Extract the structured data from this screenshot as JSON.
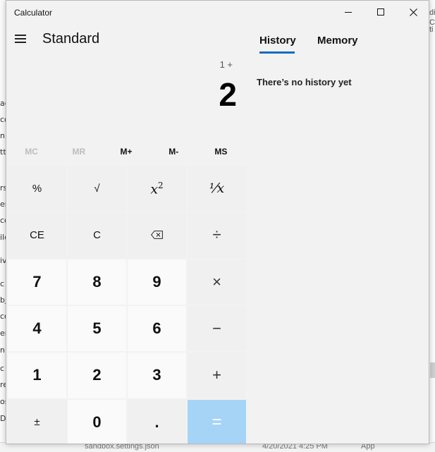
{
  "background_app": {
    "left_fragments": [
      "ac",
      "co",
      "nl",
      "tt",
      "rs",
      "en",
      "co",
      "ile",
      "iv",
      "c",
      "bj",
      "co",
      "en",
      "nl",
      "c",
      "re",
      "os",
      "D"
    ],
    "right_fragments": [
      "C",
      "di",
      "ti"
    ],
    "bottom_fragments": [
      "sandbox.settings.json",
      "4/20/2021 4:25 PM",
      "App"
    ]
  },
  "window": {
    "title": "Calculator",
    "mode_title": "Standard"
  },
  "display": {
    "expression": "1 +",
    "result": "2"
  },
  "memory_row": [
    {
      "label": "MC",
      "enabled": false
    },
    {
      "label": "MR",
      "enabled": false
    },
    {
      "label": "M+",
      "enabled": true
    },
    {
      "label": "M-",
      "enabled": true
    },
    {
      "label": "MS",
      "enabled": true
    }
  ],
  "keys": {
    "percent": "%",
    "sqrt": "√",
    "square_base": "x",
    "square_exp": "2",
    "reciprocal": "⅟x",
    "ce": "CE",
    "c": "C",
    "divide": "÷",
    "seven": "7",
    "eight": "8",
    "nine": "9",
    "multiply": "×",
    "four": "4",
    "five": "5",
    "six": "6",
    "minus": "−",
    "one": "1",
    "two": "2",
    "three": "3",
    "plus": "+",
    "negate": "±",
    "zero": "0",
    "decimal": ".",
    "equals": "="
  },
  "panel": {
    "tab_history": "History",
    "tab_memory": "Memory",
    "empty_message": "There’s no history yet"
  },
  "colors": {
    "accent": "#0f6cbd",
    "equals_bg": "#a6d4f7"
  }
}
